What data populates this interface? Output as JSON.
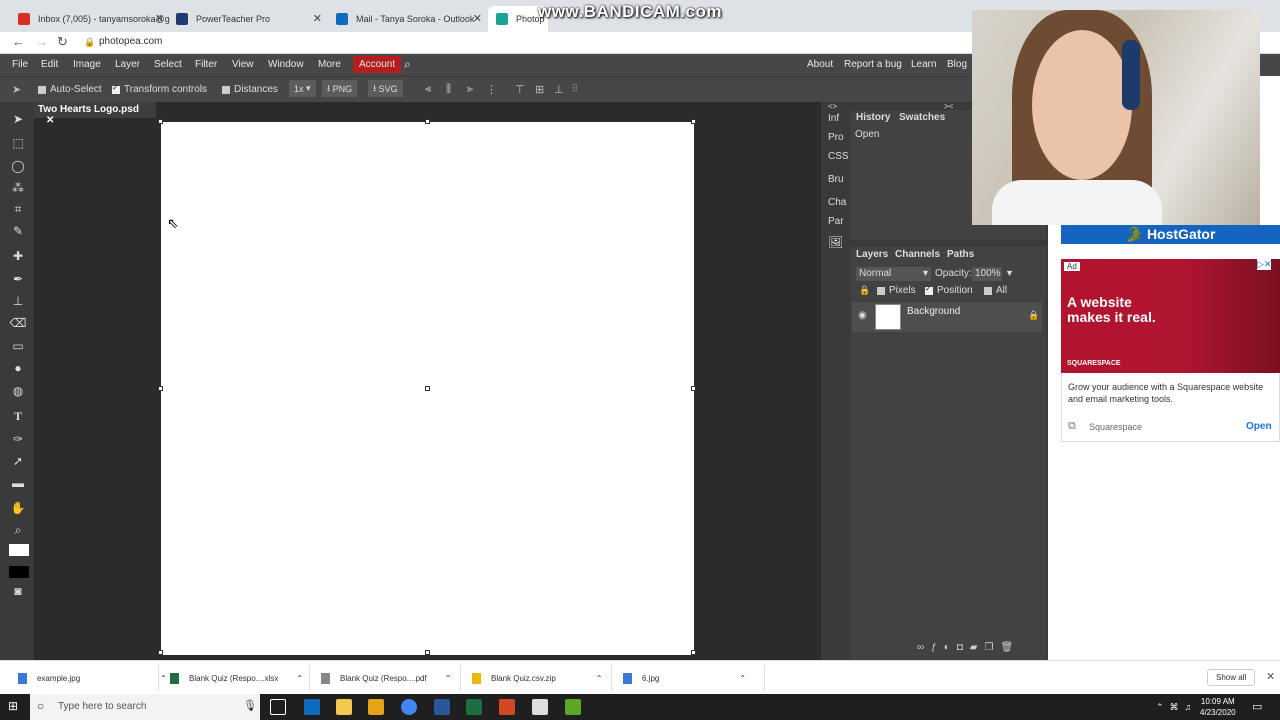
{
  "browser": {
    "tabs": [
      {
        "title": "Inbox (7,005) - tanyamsoroka@g",
        "color": "#d93025"
      },
      {
        "title": "PowerTeacher Pro",
        "color": "#1f3b73"
      },
      {
        "title": "Mail - Tanya Soroka - Outlook",
        "color": "#0f6cbd"
      },
      {
        "title": "Photop",
        "color": "#18a497"
      }
    ],
    "watermark": "www.BANDICAM.com",
    "url": "photopea.com"
  },
  "menu": {
    "items": [
      "File",
      "Edit",
      "Image",
      "Layer",
      "Select",
      "Filter",
      "View",
      "Window",
      "More"
    ],
    "account": "Account",
    "right": [
      "About",
      "Report a bug",
      "Learn",
      "Blog"
    ]
  },
  "options": {
    "auto_select": "Auto-Select",
    "transform_controls": "Transform controls",
    "distances": "Distances",
    "zoom": "1x",
    "png": "PNG",
    "svg": "SVG"
  },
  "document": {
    "tab": "Two Hearts Logo.psd"
  },
  "side_mini": [
    "Inf",
    "Pro",
    "CSS",
    "Bru",
    "Cha",
    "Par"
  ],
  "history": {
    "tabs": [
      "History",
      "Swatches"
    ],
    "items": [
      "Open"
    ]
  },
  "layers": {
    "tabs": [
      "Layers",
      "Channels",
      "Paths"
    ],
    "blend": "Normal",
    "opacity_label": "Opacity:",
    "opacity": "100%",
    "lock_options": [
      "Pixels",
      "Position",
      "All"
    ],
    "items": [
      {
        "name": "Background"
      }
    ]
  },
  "ads": {
    "hostgator": "HostGator",
    "badge": "Ad",
    "headline": "A website makes it real.",
    "brand_small": "SQUARESPACE",
    "text": "Grow your audience with a Squarespace website and email marketing tools.",
    "advertiser": "Squarespace",
    "cta": "Open"
  },
  "downloads": {
    "items": [
      "example.jpg",
      "Blank Quiz (Respo....xlsx",
      "Blank Quiz (Respo....pdf",
      "Blank Quiz.csv.zip",
      "6.jpg"
    ],
    "show_all": "Show all"
  },
  "taskbar": {
    "search_placeholder": "Type here to search",
    "time": "10:09 AM",
    "date": "4/23/2020"
  }
}
